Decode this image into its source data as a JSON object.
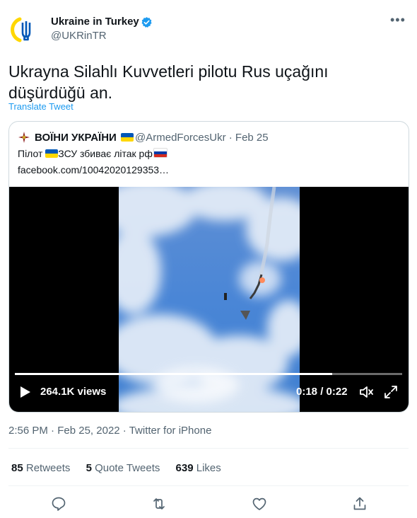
{
  "author": {
    "name": "Ukraine in Turkey",
    "handle": "@UKRinTR",
    "avatar_icon": "ukraine-trident-icon",
    "verified": true
  },
  "more_icon": "more-horizontal-icon",
  "tweet": {
    "text": "Ukrayna Silahlı Kuvvetleri pilotu Rus uçağını düşürdüğü an.",
    "translate_label": "Translate Tweet"
  },
  "quote": {
    "name": "ВОЇНИ УКРАЇНИ",
    "handle": "@ArmedForcesUkr",
    "separator": "·",
    "date": "Feb 25",
    "text_before": "Пілот ",
    "text_middle": "ЗСУ збиває літак рф",
    "link": "facebook.com/10042020129353…",
    "video": {
      "views": "264.1K views",
      "current_time": "0:18",
      "duration": "0:22",
      "progress": 0.82
    }
  },
  "meta": {
    "time": "2:56 PM",
    "date": "Feb 25, 2022",
    "source": "Twitter for iPhone",
    "separator": "·"
  },
  "stats": {
    "retweets_count": "85",
    "retweets_label": "Retweets",
    "quotes_count": "5",
    "quotes_label": "Quote Tweets",
    "likes_count": "639",
    "likes_label": "Likes"
  },
  "actions": [
    "reply-icon",
    "retweet-icon",
    "like-icon",
    "share-icon"
  ],
  "colors": {
    "accent": "#1d9bf0",
    "text": "#0f1419",
    "secondary": "#536471",
    "border": "#cfd9de",
    "ukraine_blue": "#0057b7",
    "ukraine_yellow": "#ffd700"
  }
}
